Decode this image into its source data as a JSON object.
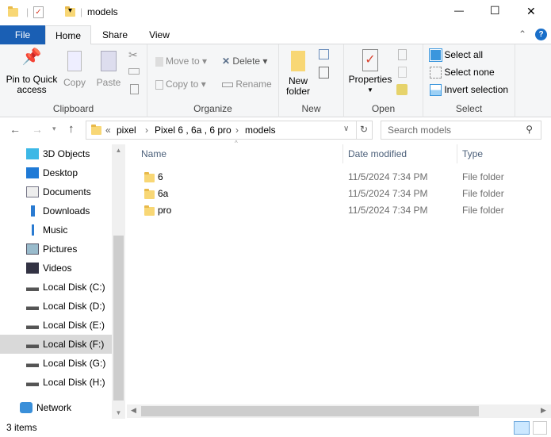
{
  "window": {
    "title": "models",
    "min": "—",
    "max": "☐",
    "close": "✕"
  },
  "tabs": [
    {
      "label": "File"
    },
    {
      "label": "Home"
    },
    {
      "label": "Share"
    },
    {
      "label": "View"
    }
  ],
  "ribbon": {
    "clipboard": {
      "label": "Clipboard",
      "pin": "Pin to Quick access",
      "copy": "Copy",
      "paste": "Paste"
    },
    "organize": {
      "label": "Organize",
      "move_to": "Move to",
      "copy_to": "Copy to",
      "delete": "Delete",
      "rename": "Rename"
    },
    "new": {
      "label": "New",
      "new_folder": "New folder"
    },
    "open": {
      "label": "Open",
      "properties": "Properties"
    },
    "select": {
      "label": "Select",
      "select_all": "Select all",
      "select_none": "Select none",
      "invert": "Invert selection"
    }
  },
  "address": {
    "crumbs": [
      "pixel",
      "Pixel 6 , 6a , 6 pro",
      "models"
    ],
    "overflow": "«"
  },
  "search": {
    "placeholder": "Search models"
  },
  "nav": [
    {
      "label": "3D Objects",
      "icon": "cube-icon"
    },
    {
      "label": "Desktop",
      "icon": "desktop-icon"
    },
    {
      "label": "Documents",
      "icon": "documents-icon"
    },
    {
      "label": "Downloads",
      "icon": "download-icon"
    },
    {
      "label": "Music",
      "icon": "music-icon"
    },
    {
      "label": "Pictures",
      "icon": "pictures-icon"
    },
    {
      "label": "Videos",
      "icon": "videos-icon"
    },
    {
      "label": "Local Disk (C:)",
      "icon": "drive-icon"
    },
    {
      "label": "Local Disk (D:)",
      "icon": "drive-icon"
    },
    {
      "label": "Local Disk (E:)",
      "icon": "drive-icon"
    },
    {
      "label": "Local Disk (F:)",
      "icon": "drive-icon",
      "selected": true
    },
    {
      "label": "Local Disk (G:)",
      "icon": "drive-icon"
    },
    {
      "label": "Local Disk (H:)",
      "icon": "drive-icon"
    },
    {
      "label": "Network",
      "icon": "network-icon"
    }
  ],
  "columns": {
    "name": "Name",
    "date": "Date modified",
    "type": "Type"
  },
  "files": [
    {
      "name": "6",
      "date": "11/5/2024 7:34 PM",
      "type": "File folder"
    },
    {
      "name": "6a",
      "date": "11/5/2024 7:34 PM",
      "type": "File folder"
    },
    {
      "name": "pro",
      "date": "11/5/2024 7:34 PM",
      "type": "File folder"
    }
  ],
  "status": {
    "count": "3 items"
  },
  "colors": {
    "file_tab": "#1a5fb4",
    "accent": "#0078d7",
    "selected": "#cce8ff"
  }
}
